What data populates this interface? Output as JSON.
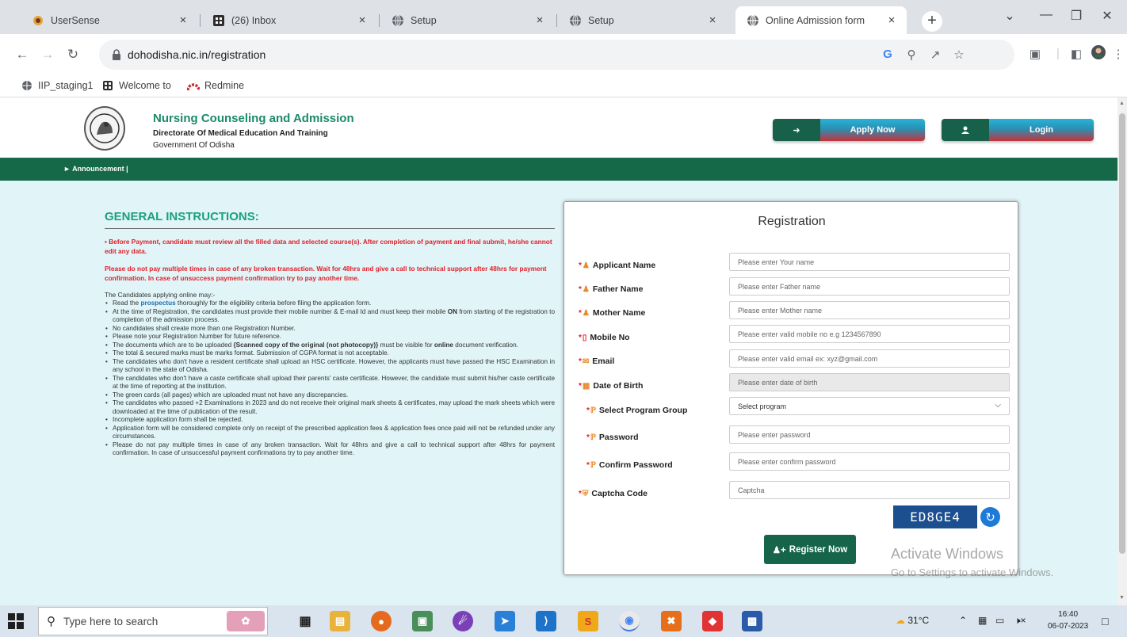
{
  "browser": {
    "tabs": [
      {
        "title": "UserSense",
        "close": "×"
      },
      {
        "title": "(26) Inbox",
        "close": "×"
      },
      {
        "title": "Setup",
        "close": "×"
      },
      {
        "title": "Setup",
        "close": "×"
      },
      {
        "title": "Online Admission form",
        "close": "×",
        "active": true
      }
    ],
    "new_tab": "+",
    "url": "dohodisha.nic.in/registration",
    "bookmarks": [
      "IIP_staging1",
      "Welcome to",
      "Redmine"
    ]
  },
  "site": {
    "title": "Nursing Counseling and Admission",
    "subtitle": "Directorate Of Medical Education And Training",
    "government": "Government Of Odisha",
    "apply_label": "Apply Now",
    "login_label": "Login",
    "announcement": "Announcement |"
  },
  "instructions": {
    "title": "GENERAL INSTRUCTIONS:",
    "warning1": "Before Payment, candidate must review all the filled data and selected course(s). After completion of payment and final submit, he/she cannot edit any data.",
    "warning2": "Please do not pay multiple times in case of any broken transaction. Wait for 48hrs and give a call to technical support after 48hrs for payment confirmation. In case of unsuccess payment confirmation try to pay another time.",
    "intro": "The Candidates applying online may:-",
    "item1_pre": "Read the ",
    "item1_link": "prospectus",
    "item1_post": " thoroughly for the eligibility criteria before filing the application form.",
    "item2_pre": "At the time of Registration, the candidates must provide their mobile number & E-mail Id and must keep their mobile ",
    "item2_bold": "ON",
    "item2_post": " from starting of the registration to completion of the admission process.",
    "item3": "No candidates shall create more than one Registration Number.",
    "item4": "Please note your Registration Number for future reference.",
    "item5_pre": "The documents which are to be uploaded ",
    "item5_bold": "{Scanned copy of the original (not photocopy)}",
    "item5_mid": " must be visible for ",
    "item5_bold2": "online",
    "item5_post": " document verification.",
    "item6": "The total & secured marks must be marks format. Submission of CGPA format is not acceptable.",
    "item7": "The candidates who don't have a resident certificate shall upload an HSC certificate. However, the applicants must have passed the HSC Examination in any school in the state of Odisha.",
    "item8": "The candidates who don't have a caste certificate shall upload their parents' caste certificate. However, the candidate must submit his/her caste certificate at the time of reporting at the institution.",
    "item9": "The green cards (all pages) which are uploaded must not have any discrepancies.",
    "item10": "The candidates who passed +2 Examinations in 2023 and do not receive their original mark sheets & certificates, may upload the mark sheets which were downloaded at the time of publication of the result.",
    "item11": "Incomplete application form shall be rejected.",
    "item12": "Application form will be considered complete only on receipt of the prescribed application fees & application fees once paid will not be refunded under any circumstances.",
    "item13": "Please do not pay multiple times in case of any broken transaction. Wait for 48hrs and give a call to technical support after 48hrs for payment confirmation. In case of unsuccessful payment confirmations try to pay another time."
  },
  "registration": {
    "title": "Registration",
    "required_mark": "*",
    "fields": [
      {
        "label": "Applicant Name",
        "placeholder": "Please enter Your name"
      },
      {
        "label": "Father Name",
        "placeholder": "Please enter Father name"
      },
      {
        "label": "Mother Name",
        "placeholder": "Please enter Mother name"
      },
      {
        "label": "Mobile No",
        "placeholder": "Please enter valid mobile no e.g 1234567890"
      },
      {
        "label": "Email",
        "placeholder": "Please enter valid email ex: xyz@gmail.com"
      },
      {
        "label": "Date of Birth",
        "placeholder": "Please enter date of birth"
      },
      {
        "label": "Select Program Group",
        "placeholder": "Select program"
      },
      {
        "label": "Password",
        "placeholder": "Please enter password"
      },
      {
        "label": "Confirm Password",
        "placeholder": "Please enter confirm password"
      },
      {
        "label": "Captcha Code",
        "placeholder": "Captcha"
      }
    ],
    "captcha_text": "ED8GE4",
    "register_label": "Register Now"
  },
  "watermark": {
    "line1": "Activate Windows",
    "line2": "Go to Settings to activate Windows."
  },
  "taskbar": {
    "search_placeholder": "Type here to search",
    "temperature": "31°C",
    "time": "16:40",
    "date": "06-07-2023"
  },
  "colors": {
    "brand_green": "#156948",
    "title_green": "#1aa07f",
    "warning_red": "#e0202a",
    "page_bg": "#e1f4f7"
  }
}
